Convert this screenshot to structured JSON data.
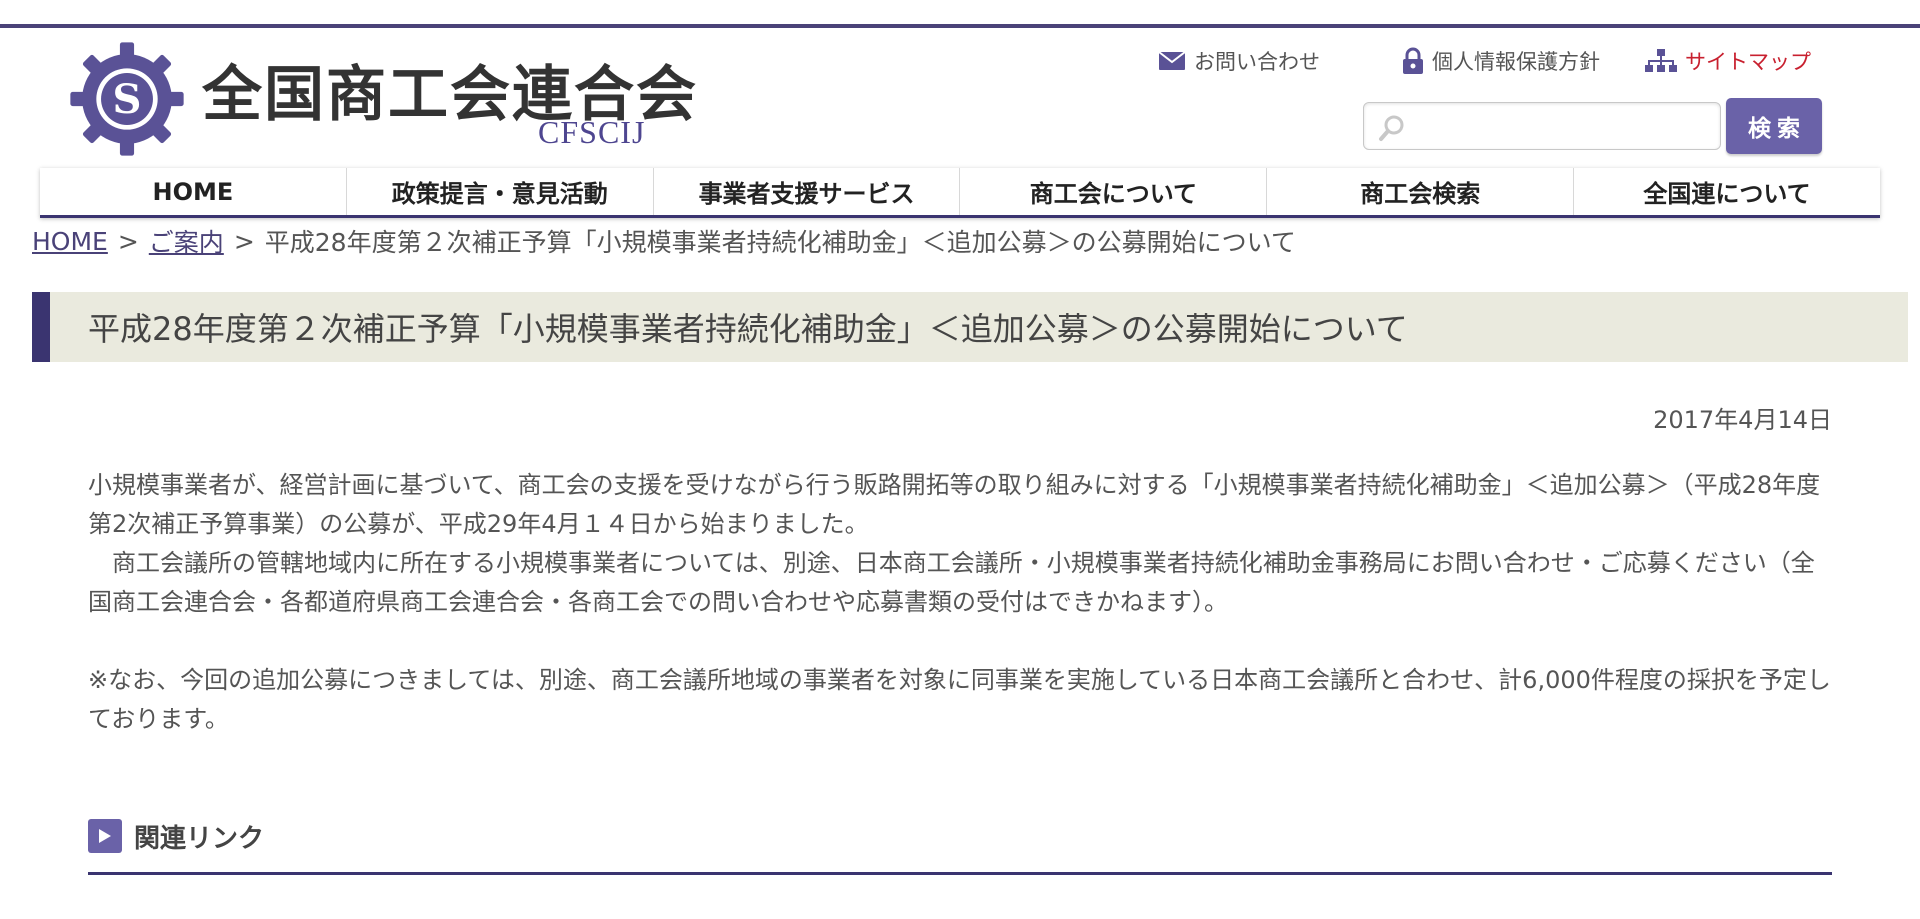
{
  "logo": {
    "title": "全国商工会連合会",
    "subtitle": "CFSCIJ",
    "emblem_letter": "S",
    "brand_color": "#5a5296"
  },
  "utility": {
    "contact": "お問い合わせ",
    "privacy": "個人情報保護方針",
    "sitemap": "サイトマップ",
    "contact_icon": "mail-icon",
    "privacy_icon": "lock-icon",
    "sitemap_icon": "sitemap-icon"
  },
  "search": {
    "placeholder": "",
    "value": "",
    "button_label": "検索",
    "icon": "search-icon"
  },
  "nav": {
    "items": [
      {
        "label": "HOME"
      },
      {
        "label": "政策提言・意見活動"
      },
      {
        "label": "事業者支援サービス"
      },
      {
        "label": "商工会について"
      },
      {
        "label": "商工会検索"
      },
      {
        "label": "全国連について"
      }
    ]
  },
  "breadcrumb": {
    "home": "HOME",
    "sep": ">",
    "category": "ご案内",
    "current": "平成28年度第２次補正予算「小規模事業者持続化補助金」＜追加公募＞の公募開始について"
  },
  "page": {
    "title": "平成28年度第２次補正予算「小規模事業者持続化補助金」＜追加公募＞の公募開始について",
    "date": "2017年4月14日",
    "paragraphs": [
      "小規模事業者が、経営計画に基づいて、商工会の支援を受けながら行う販路開拓等の取り組みに対する「小規模事業者持続化補助金」＜追加公募＞（平成28年度第2次補正予算事業）の公募が、平成29年4月１４日から始まりました。",
      "　商工会議所の管轄地域内に所在する小規模事業者については、別途、日本商工会議所・小規模事業者持続化補助金事務局にお問い合わせ・ご応募ください（全国商工会連合会・各都道府県商工会連合会・各商工会での問い合わせや応募書類の受付はできかねます）。",
      "※なお、今回の追加公募につきましては、別途、商工会議所地域の事業者を対象に同事業を実施している日本商工会議所と合わせ、計6,000件程度の採択を予定しております。"
    ],
    "related_heading": "関連リンク",
    "related_icon": "play-arrow-icon"
  },
  "colors": {
    "accent": "#3a3470",
    "button": "#6a62a8",
    "sitemap_link": "#c8202f",
    "title_bg": "#eaeade"
  }
}
